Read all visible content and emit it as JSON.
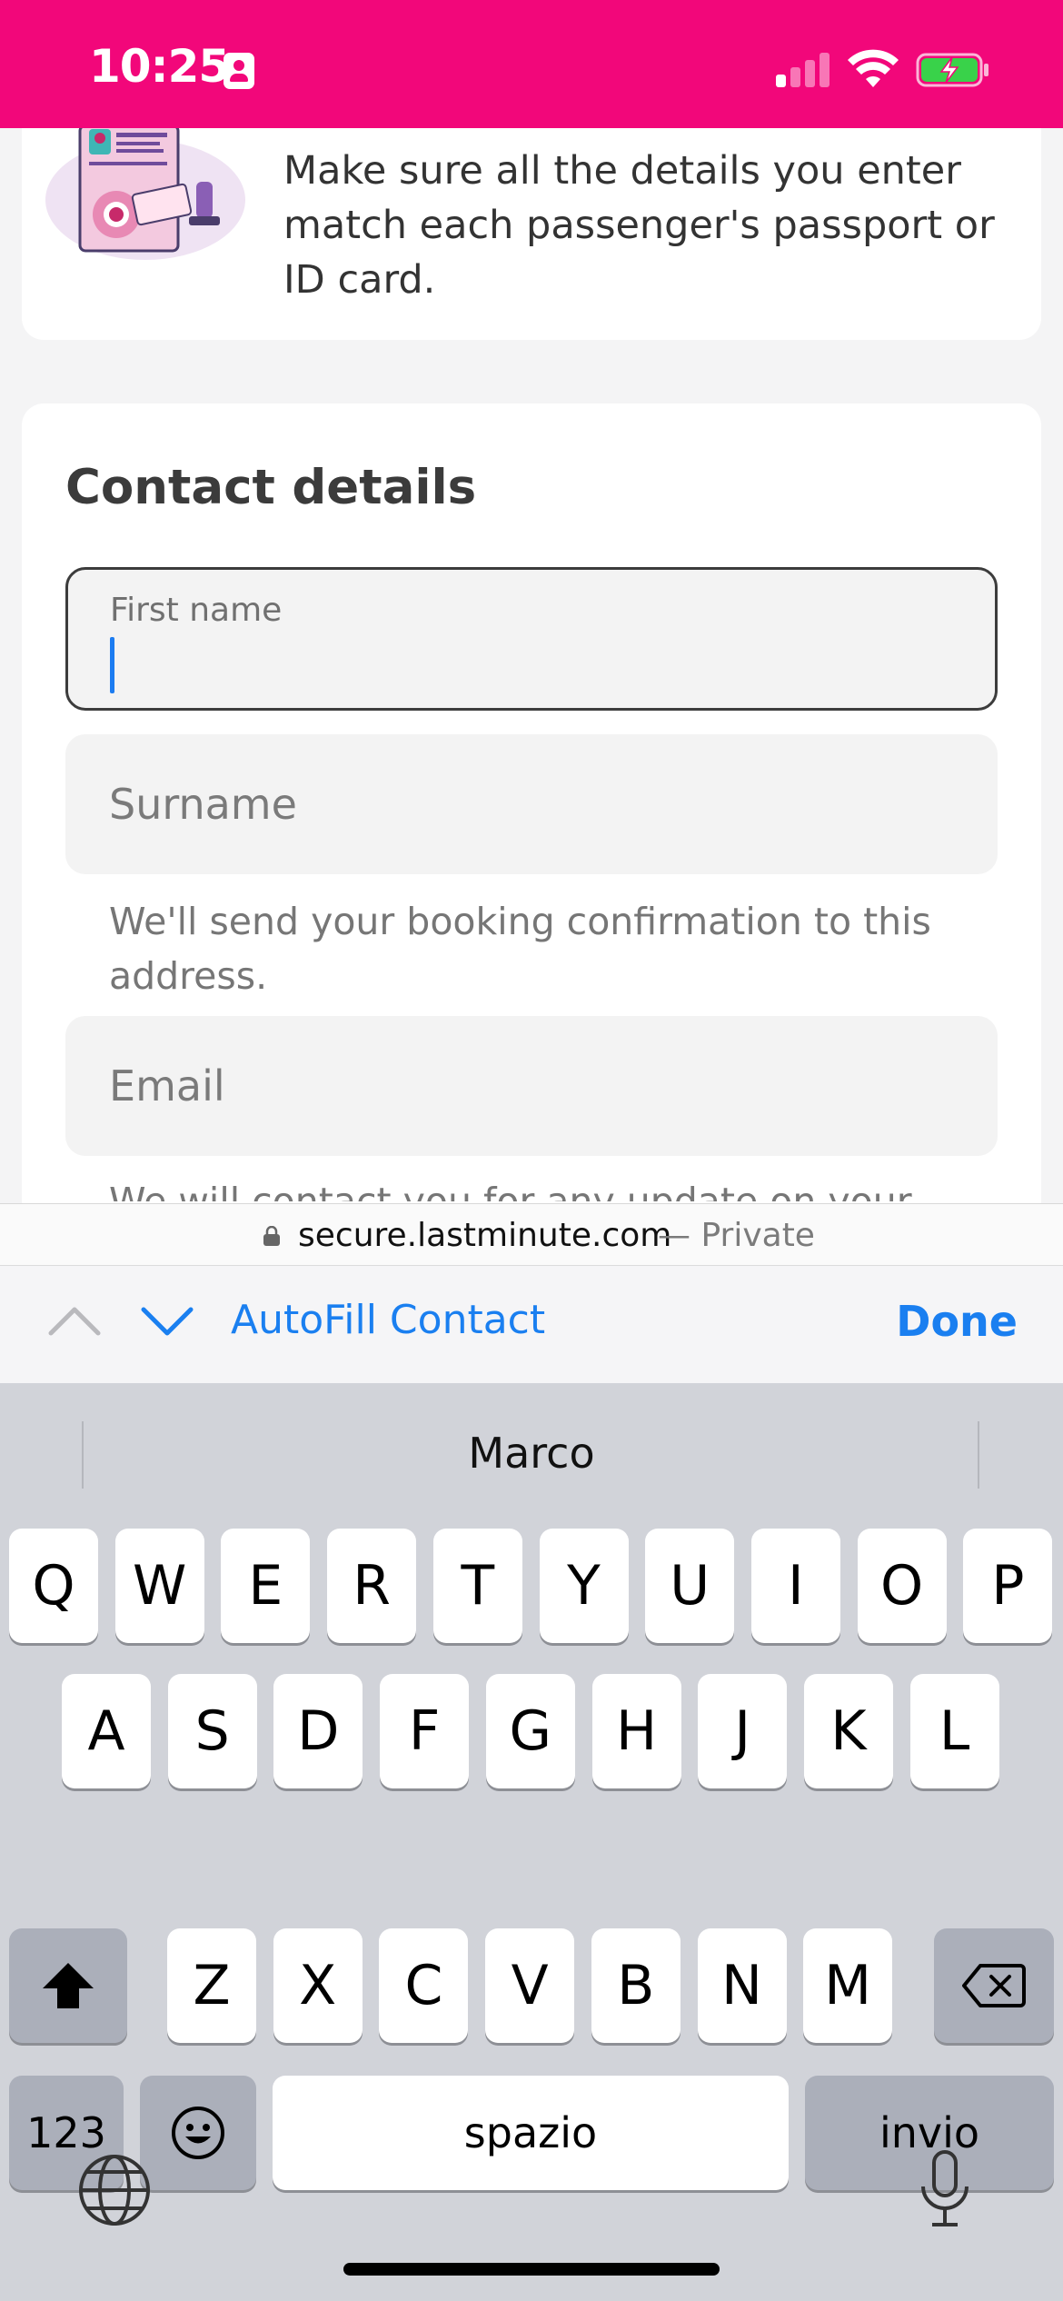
{
  "status_bar": {
    "time": "10:25",
    "background": "#f2077a",
    "icons": [
      "contact-card-icon",
      "cellular-signal-icon",
      "wifi-icon",
      "battery-charging-icon"
    ]
  },
  "passport_notice": {
    "text": "Make sure all the details you enter match each passenger's passport or ID card."
  },
  "contact_details": {
    "title": "Contact details",
    "first_name_label": "First name",
    "first_name_value": "",
    "surname_placeholder": "Surname",
    "helper_text": "We'll send your booking confirmation to this address.",
    "email_placeholder": "Email",
    "helper_text_2": "We will contact you for any update on your trip"
  },
  "url_bar": {
    "domain": "secure.lastminute.com",
    "suffix": "— Private"
  },
  "accessory_bar": {
    "autofill_label": "AutoFill Contact",
    "done_label": "Done",
    "accent": "#1a7ff0"
  },
  "keyboard": {
    "suggestion": "Marco",
    "row1": [
      "Q",
      "W",
      "E",
      "R",
      "T",
      "Y",
      "U",
      "I",
      "O",
      "P"
    ],
    "row2": [
      "A",
      "S",
      "D",
      "F",
      "G",
      "H",
      "J",
      "K",
      "L"
    ],
    "row3": [
      "Z",
      "X",
      "C",
      "V",
      "B",
      "N",
      "M"
    ],
    "numbers_label": "123",
    "space_label": "spazio",
    "return_label": "invio"
  }
}
